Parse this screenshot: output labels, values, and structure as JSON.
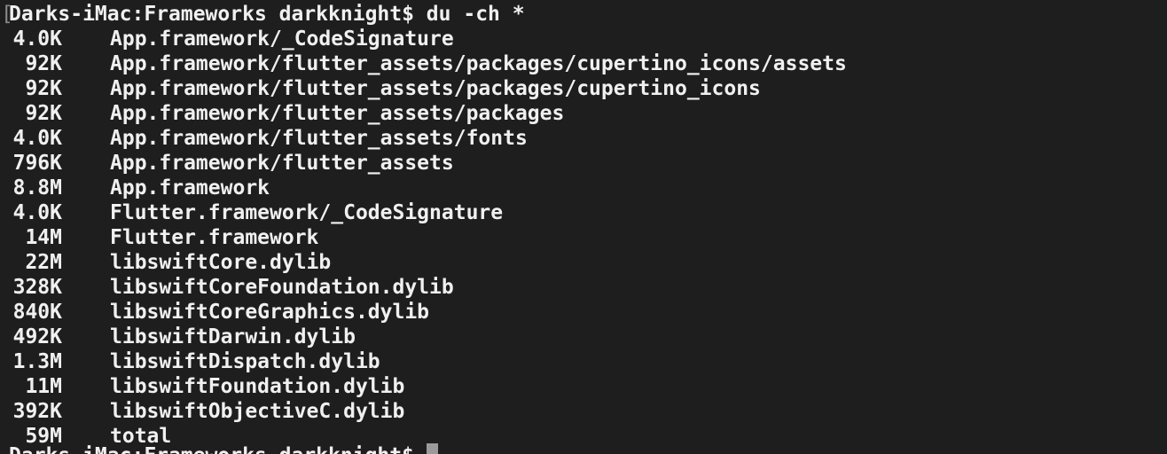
{
  "window": {
    "bracket_glyph": "[",
    "prompt_command": "Darks-iMac:Frameworks darkknight$ du -ch *",
    "next_prompt": "Darks-iMac:Frameworks darkknight$ "
  },
  "output": [
    {
      "size": "4.0K",
      "path": "App.framework/_CodeSignature"
    },
    {
      "size": "92K",
      "path": "App.framework/flutter_assets/packages/cupertino_icons/assets"
    },
    {
      "size": "92K",
      "path": "App.framework/flutter_assets/packages/cupertino_icons"
    },
    {
      "size": "92K",
      "path": "App.framework/flutter_assets/packages"
    },
    {
      "size": "4.0K",
      "path": "App.framework/flutter_assets/fonts"
    },
    {
      "size": "796K",
      "path": "App.framework/flutter_assets"
    },
    {
      "size": "8.8M",
      "path": "App.framework"
    },
    {
      "size": "4.0K",
      "path": "Flutter.framework/_CodeSignature"
    },
    {
      "size": "14M",
      "path": "Flutter.framework"
    },
    {
      "size": "22M",
      "path": "libswiftCore.dylib"
    },
    {
      "size": "328K",
      "path": "libswiftCoreFoundation.dylib"
    },
    {
      "size": "840K",
      "path": "libswiftCoreGraphics.dylib"
    },
    {
      "size": "492K",
      "path": "libswiftDarwin.dylib"
    },
    {
      "size": "1.3M",
      "path": "libswiftDispatch.dylib"
    },
    {
      "size": "11M",
      "path": "libswiftFoundation.dylib"
    },
    {
      "size": "392K",
      "path": "libswiftObjectiveC.dylib"
    },
    {
      "size": "59M",
      "path": "total"
    }
  ],
  "colors": {
    "background": "#1e1e1e",
    "text": "#f0f0f0",
    "cursor": "#9a9a9a"
  }
}
